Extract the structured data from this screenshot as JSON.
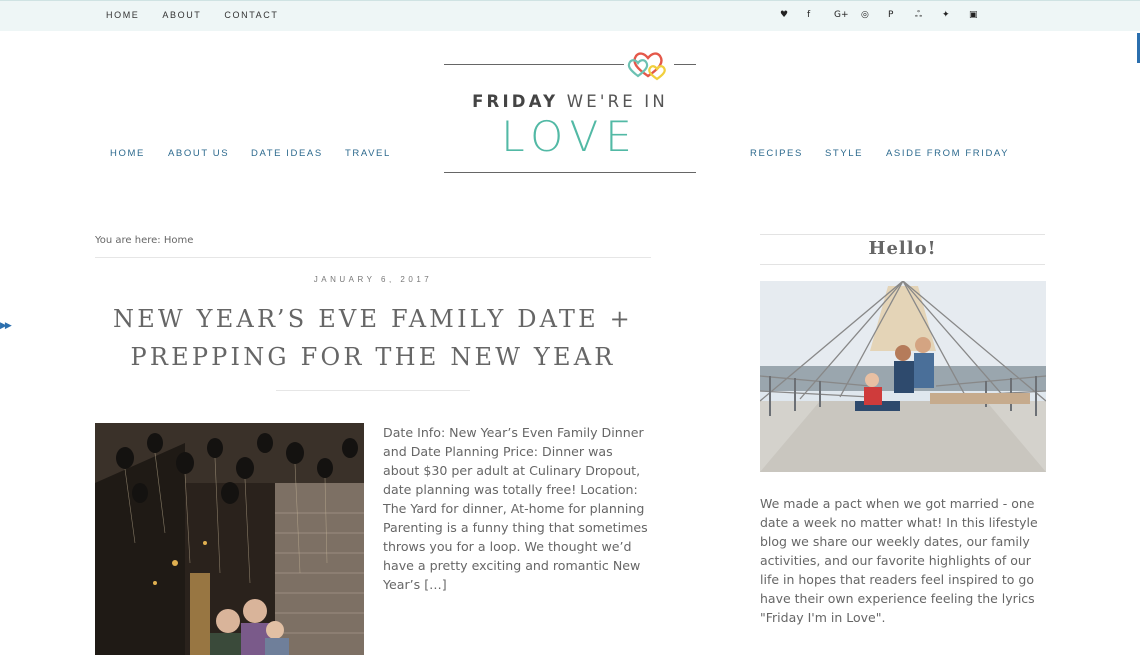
{
  "topbar": {
    "nav": [
      "HOME",
      "ABOUT",
      "CONTACT"
    ],
    "social_icons": [
      {
        "name": "heart-icon",
        "glyph": "♥"
      },
      {
        "name": "facebook-icon",
        "glyph": "f"
      },
      {
        "name": "google-plus-icon",
        "glyph": "G+"
      },
      {
        "name": "instagram-icon",
        "glyph": "◎"
      },
      {
        "name": "pinterest-icon",
        "glyph": "P"
      },
      {
        "name": "stumbleupon-icon",
        "glyph": "ஃ"
      },
      {
        "name": "twitter-icon",
        "glyph": "✦"
      },
      {
        "name": "youtube-icon",
        "glyph": "▣"
      }
    ]
  },
  "logo": {
    "line1_bold": "FRIDAY",
    "line1_rest": "WE'RE IN",
    "line2": "LOVE",
    "accent": "#52b9a5"
  },
  "mainnav": {
    "left": [
      "HOME",
      "ABOUT US",
      "DATE IDEAS",
      "TRAVEL"
    ],
    "right": [
      "RECIPES",
      "STYLE",
      "ASIDE FROM FRIDAY"
    ]
  },
  "breadcrumb": "You are here: Home",
  "post": {
    "date": "JANUARY 6, 2017",
    "title_line1": "NEW YEAR’S EVE FAMILY DATE +",
    "title_line2": "PREPPING FOR THE NEW YEAR",
    "excerpt": "Date Info: New Year’s Even Family Dinner and Date Planning Price: Dinner was about $30 per adult at Culinary Dropout, date planning was totally free! Location: The Yard for dinner, At-home for planning Parenting is a funny thing that sometimes throws you for a loop. We thought we’d have a pretty exciting and romantic New Year’s […]"
  },
  "sidebar": {
    "heading": "Hello!",
    "about": "We made a pact when we got married - one date a week no matter what! In this lifestyle blog we share our weekly dates, our family activities, and our favorite highlights of our life in hopes that readers feel inspired to go have their own experience feeling the lyrics \"Friday I'm in Love\"."
  },
  "colors": {
    "nav_blue": "#2d6a8e",
    "topbar_bg": "#eef6f6"
  }
}
